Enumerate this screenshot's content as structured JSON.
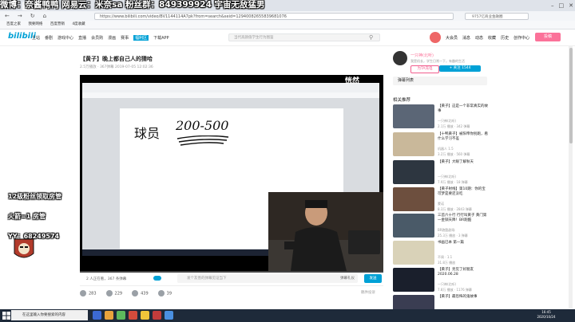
{
  "overlay_text": "微博：奈酱鸭鸭  网易云：米奈sa  粉丝群：849399924          宇宙无敌猛男",
  "browser": {
    "tab_label": "百度图片",
    "url": "https://www.bilibili.com/video/BV1144114A7pk?from=search&seid=12940082655839681076",
    "side_search": "9757亿商业金融圈",
    "bookmarks": [
      "百度之家",
      "我要网络",
      "百度营销",
      "4度收藏"
    ]
  },
  "bili": {
    "logo": "bilibili",
    "nav": [
      "主站",
      "番剧",
      "游戏中心",
      "直播",
      "会员购",
      "漫画",
      "赛事",
      "福利区",
      "下载APP"
    ],
    "search_placeholder": "当代高颜值学生行为图鉴",
    "right_nav": [
      "大会员",
      "消息",
      "动态",
      "收藏",
      "历史",
      "创作中心"
    ],
    "upload": "投稿"
  },
  "video": {
    "title": "【黄子】晚上都自己人的猜哈",
    "meta": "2.5万播放 · 367弹幕    2019-07-05 12:02:36",
    "watermark": "恍然",
    "paper_text_1": "球员",
    "paper_text_2": "200-500"
  },
  "left_overlay": {
    "line1": "12级粉丝领取房管",
    "line2": "火箭=1 房管",
    "line3": "YY：68249574"
  },
  "danmaku": {
    "watching": "2 人正在看，367 条弹幕",
    "placeholder": "发个友善的弹幕见证当下",
    "etiquette": "弹幕礼仪",
    "send": "发送"
  },
  "actions": [
    {
      "name": "like",
      "label": "283"
    },
    {
      "name": "coin",
      "label": "229"
    },
    {
      "name": "favorite",
      "label": "439"
    },
    {
      "name": "share",
      "label": "39"
    }
  ],
  "report": "稿件投诉",
  "up": {
    "name": "一只神(北听)",
    "desc": "我是机长，学生日常一下，有趣的生活",
    "charge": "为TA充电",
    "follow": "+ 关注 1544"
  },
  "right": {
    "dm_list": "弹幕列表",
    "rec_title": "相关推荐",
    "recs": [
      {
        "title": "【黄子】这是一个非常真实的故事",
        "author": "一只神(北听)",
        "stats": "2.1万 播放 · 342 弹幕",
        "color": "#5b6676"
      },
      {
        "title": "【十鸭黄子】被阳帝你别跑，看什么学习不差",
        "author": "机器人 1.5",
        "stats": "3.2万 播放 · 560 弹幕",
        "color": "#c9b89a"
      },
      {
        "title": "【黄子】大眼了解秋天",
        "author": "一只神(北听)",
        "stats": "7.9万 播放 · 18 弹幕",
        "color": "#2d3640"
      },
      {
        "title": "【黄子射线】第10期：你的宝可梦是要还没吃",
        "author": "蒙诺",
        "stats": "8.3万 播放 · 2843 弹幕",
        "color": "#6d4f3e"
      },
      {
        "title": "三首六十行 行行叫黄子 黄门第一金钏天降！BR跑酷",
        "author": "BR跑酷剧场",
        "stats": "25.3万 播放 · 3 弹幕",
        "color": "#4a5a68"
      },
      {
        "title": "书画已本 第一篇",
        "author": "不周 · 1.1",
        "stats": "31.8万 播放",
        "color": "#d9d2b8"
      },
      {
        "title": "【黄子】亮见了好朋友 2020.06.28",
        "author": "一只神(北听)",
        "stats": "7.8万 播放 · 1176 弹幕",
        "color": "#1a1f2c"
      },
      {
        "title": "【黄子】最恐怖的鬼故事",
        "author": "",
        "stats": "",
        "color": "#3a3d52"
      }
    ]
  },
  "taskbar": {
    "search": "在这里输入你要搜索的内容",
    "time": "16:45",
    "date": "2020/10/24"
  }
}
